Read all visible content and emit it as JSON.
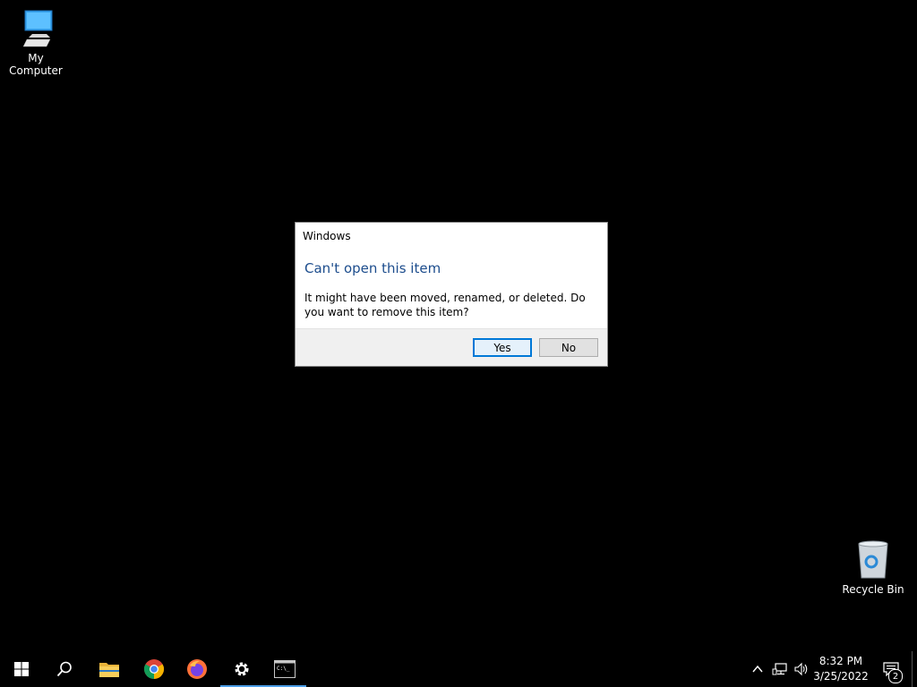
{
  "desktop": {
    "icons": [
      {
        "label": "My Computer",
        "icon": "monitor-icon"
      },
      {
        "label": "Recycle Bin",
        "icon": "recycle-bin-icon"
      }
    ]
  },
  "dialog": {
    "title": "Windows",
    "heading": "Can't open this item",
    "message": "It might have been moved, renamed, or deleted. Do you want to remove this item?",
    "yes_label": "Yes",
    "no_label": "No",
    "heading_color": "#1d4d8d"
  },
  "taskbar": {
    "items": [
      {
        "name": "start",
        "icon": "windows-logo-icon"
      },
      {
        "name": "search",
        "icon": "search-icon"
      },
      {
        "name": "file-explorer",
        "icon": "folder-icon"
      },
      {
        "name": "chrome",
        "icon": "chrome-icon"
      },
      {
        "name": "firefox",
        "icon": "firefox-icon"
      },
      {
        "name": "settings",
        "icon": "gear-icon",
        "active": true
      },
      {
        "name": "terminal",
        "icon": "terminal-icon",
        "active": true
      }
    ],
    "tray": {
      "time": "8:32 PM",
      "date": "3/25/2022",
      "notification_count": "2"
    },
    "accent": "#4c9ee8"
  }
}
